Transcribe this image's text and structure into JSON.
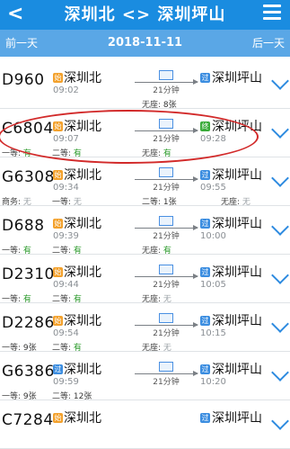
{
  "header": {
    "back_icon": "chevron-left-icon",
    "route": "深圳北 <> 深圳坪山",
    "menu_icon": "menu-icon"
  },
  "datebar": {
    "prev_label": "前一天",
    "date": "2018-11-11",
    "next_label": "后一天"
  },
  "colors": {
    "title_bg": "#1a8ce0",
    "date_bg": "#5aa7e6",
    "available": "#2a9a2a",
    "highlight": "#d22a2a"
  },
  "trains": [
    {
      "no": "D960",
      "dep_badge": "始",
      "dep_station": "深圳北",
      "dep_time": "09:02",
      "duration": "21分钟",
      "arr_badge": "过",
      "arr_station": "深圳坪山",
      "arr_time": "",
      "seats": [
        {
          "text": "",
          "status": ""
        },
        {
          "text": "",
          "status": ""
        },
        {
          "text": "无座: 8张",
          "status": "black"
        },
        {
          "text": "",
          "status": ""
        }
      ]
    },
    {
      "no": "C6804",
      "dep_badge": "始",
      "dep_station": "深圳北",
      "dep_time": "09:07",
      "duration": "21分钟",
      "arr_badge": "终",
      "arr_station": "深圳坪山",
      "arr_time": "09:28",
      "seats": [
        {
          "text": "一等: 有",
          "status": "green"
        },
        {
          "text": "二等: 有",
          "status": "green"
        },
        {
          "text": "无座: 有",
          "status": "green"
        },
        {
          "text": "",
          "status": ""
        }
      ]
    },
    {
      "no": "G6308",
      "dep_badge": "始",
      "dep_station": "深圳北",
      "dep_time": "09:34",
      "duration": "21分钟",
      "arr_badge": "过",
      "arr_station": "深圳坪山",
      "arr_time": "09:55",
      "seats": [
        {
          "text": "商务: 无",
          "status": "gray"
        },
        {
          "text": "一等: 无",
          "status": "gray"
        },
        {
          "text": "二等: 1张",
          "status": "black"
        },
        {
          "text": "无座: 无",
          "status": "gray"
        }
      ]
    },
    {
      "no": "D688",
      "dep_badge": "始",
      "dep_station": "深圳北",
      "dep_time": "09:39",
      "duration": "21分钟",
      "arr_badge": "过",
      "arr_station": "深圳坪山",
      "arr_time": "10:00",
      "seats": [
        {
          "text": "一等: 有",
          "status": "green"
        },
        {
          "text": "二等: 有",
          "status": "green"
        },
        {
          "text": "无座: 有",
          "status": "green"
        },
        {
          "text": "",
          "status": ""
        }
      ]
    },
    {
      "no": "D2310",
      "dep_badge": "始",
      "dep_station": "深圳北",
      "dep_time": "09:44",
      "duration": "21分钟",
      "arr_badge": "过",
      "arr_station": "深圳坪山",
      "arr_time": "10:05",
      "seats": [
        {
          "text": "一等: 有",
          "status": "green"
        },
        {
          "text": "二等: 有",
          "status": "green"
        },
        {
          "text": "无座: 无",
          "status": "gray"
        },
        {
          "text": "",
          "status": ""
        }
      ]
    },
    {
      "no": "D2286",
      "dep_badge": "始",
      "dep_station": "深圳北",
      "dep_time": "09:54",
      "duration": "21分钟",
      "arr_badge": "过",
      "arr_station": "深圳坪山",
      "arr_time": "10:15",
      "seats": [
        {
          "text": "一等: 9张",
          "status": "black"
        },
        {
          "text": "二等: 有",
          "status": "green"
        },
        {
          "text": "无座: 无",
          "status": "gray"
        },
        {
          "text": "",
          "status": ""
        }
      ]
    },
    {
      "no": "G6386",
      "dep_badge": "过",
      "dep_station": "深圳北",
      "dep_time": "09:59",
      "duration": "21分钟",
      "arr_badge": "过",
      "arr_station": "深圳坪山",
      "arr_time": "10:20",
      "seats": [
        {
          "text": "一等: 9张",
          "status": "black"
        },
        {
          "text": "二等: 12张",
          "status": "black"
        },
        {
          "text": "",
          "status": ""
        },
        {
          "text": "",
          "status": ""
        }
      ]
    },
    {
      "no": "C7284",
      "dep_badge": "始",
      "dep_station": "深圳北",
      "dep_time": "",
      "duration": "",
      "arr_badge": "过",
      "arr_station": "深圳坪山",
      "arr_time": "",
      "seats": [
        {
          "text": "",
          "status": ""
        },
        {
          "text": "",
          "status": ""
        },
        {
          "text": "",
          "status": ""
        },
        {
          "text": "",
          "status": ""
        }
      ]
    }
  ]
}
